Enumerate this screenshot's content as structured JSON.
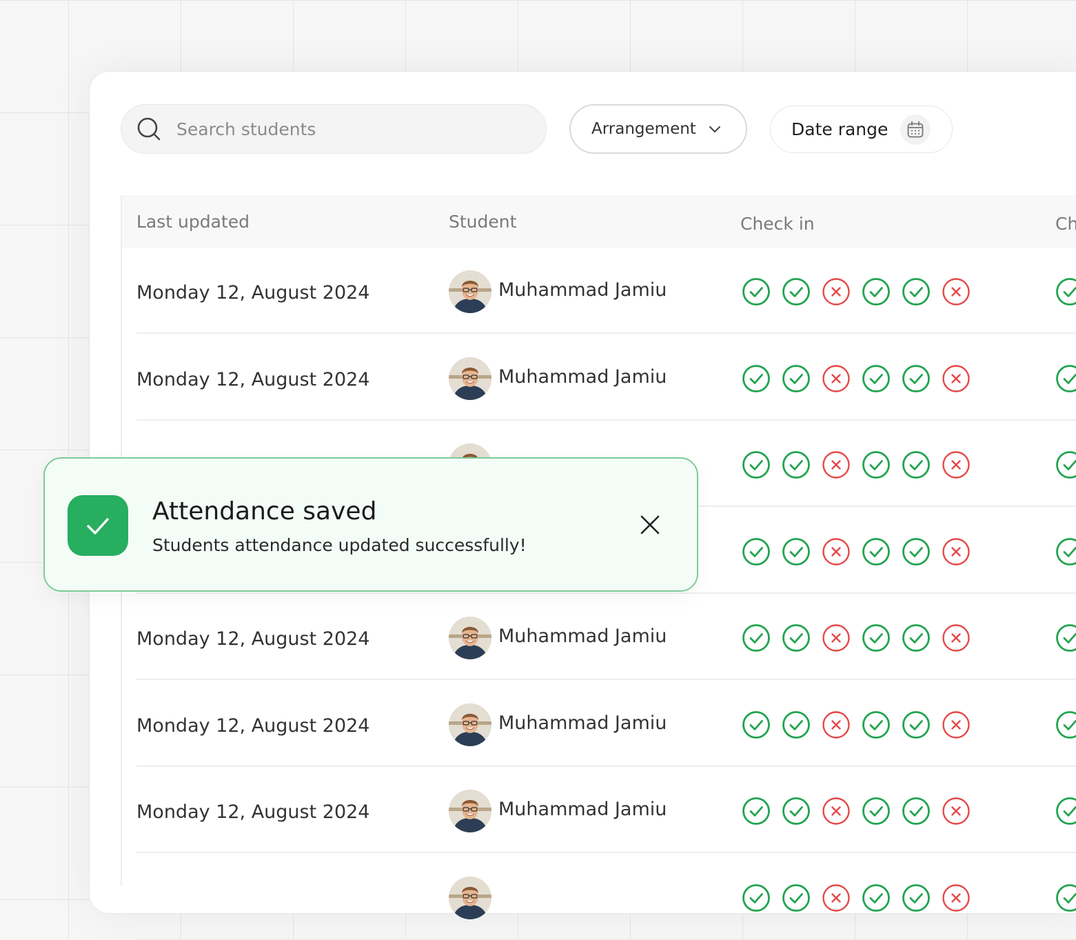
{
  "search": {
    "placeholder": "Search students",
    "icon": "search-icon"
  },
  "filters": {
    "arrangement_label": "Arrangement",
    "arrangement_icon": "chevron-down-icon",
    "date_range_label": "Date range",
    "date_range_icon": "calendar-icon"
  },
  "table": {
    "columns": [
      "Last updated",
      "Student",
      "Check in",
      "Ch"
    ],
    "row_pattern": [
      "check",
      "check",
      "cross",
      "check",
      "check",
      "cross"
    ],
    "rows": [
      {
        "last_updated": "Monday 12, August 2024",
        "student": "Muhammad Jamiu"
      },
      {
        "last_updated": "Monday 12, August 2024",
        "student": "Muhammad Jamiu"
      },
      {
        "last_updated": "",
        "student": ""
      },
      {
        "last_updated": "",
        "student": ""
      },
      {
        "last_updated": "Monday 12, August 2024",
        "student": "Muhammad Jamiu"
      },
      {
        "last_updated": "Monday 12, August 2024",
        "student": "Muhammad Jamiu"
      },
      {
        "last_updated": "Monday 12, August 2024",
        "student": "Muhammad Jamiu"
      },
      {
        "last_updated": "",
        "student": ""
      }
    ]
  },
  "toast": {
    "title": "Attendance saved",
    "message": "Students attendance updated successfully!",
    "icon": "check-icon",
    "close_icon": "close-icon"
  },
  "colors": {
    "success": "#27ae5f",
    "present": "#22a44f",
    "absent": "#e54848",
    "toast_bg": "#f3fcf6",
    "toast_border": "#7ccb99"
  }
}
